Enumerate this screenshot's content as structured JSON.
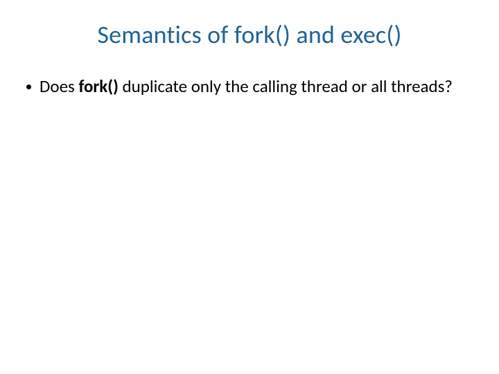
{
  "slide": {
    "title": "Semantics of fork() and exec()",
    "bullets": [
      {
        "prefix": "Does ",
        "bold": "fork()",
        "suffix": " duplicate only the calling thread or all threads?"
      }
    ]
  }
}
